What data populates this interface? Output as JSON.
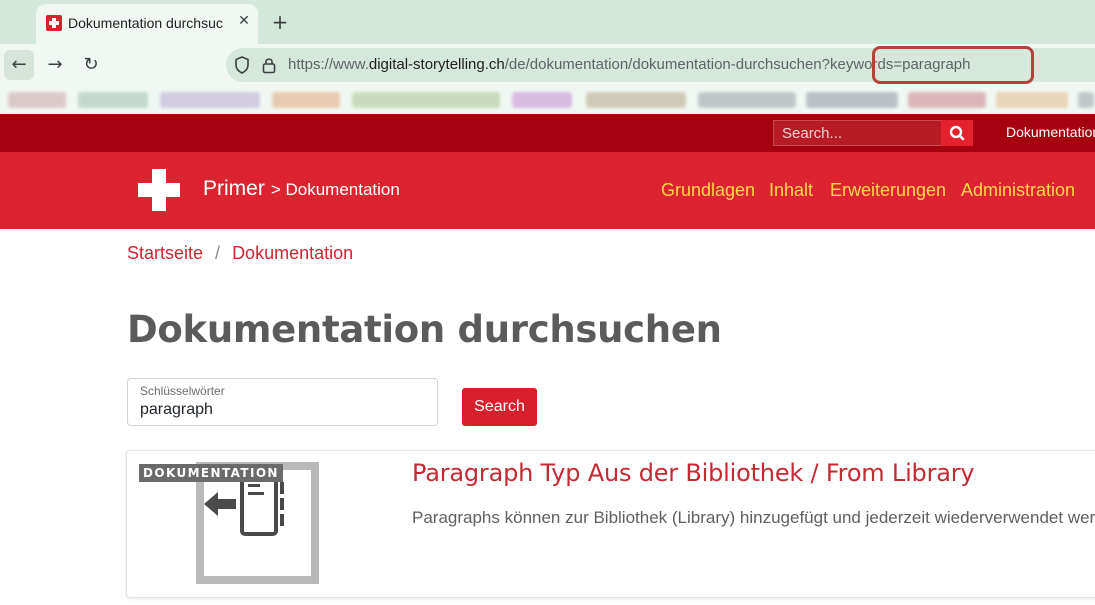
{
  "browser": {
    "tab": {
      "title": "Dokumentation durchsuc",
      "close_glyph": "✕"
    },
    "new_tab_glyph": "+",
    "nav": {
      "back_glyph": "←",
      "forward_glyph": "→",
      "reload_glyph": "↻"
    },
    "url": {
      "scheme": "https://www.",
      "host": "digital-storytelling.ch",
      "path": "/de/dokumentation/dokumentation-durchsuchen?keywords=paragraph"
    },
    "bookmarks_blurred": true
  },
  "site": {
    "topbar": {
      "search_placeholder": "Search...",
      "link": "Dokumentation"
    },
    "header": {
      "brand": "Primer",
      "section": "> Dokumentation",
      "nav": [
        "Grundlagen",
        "Inhalt",
        "Erweiterungen",
        "Administration"
      ]
    },
    "breadcrumb": {
      "items": [
        "Startseite",
        "Dokumentation"
      ],
      "separator": "/"
    },
    "page_title": "Dokumentation durchsuchen",
    "form": {
      "field_label": "Schlüsselwörter",
      "field_value": "paragraph",
      "submit_label": "Search"
    },
    "results": [
      {
        "badge": "DOKUMENTATION",
        "title": "Paragraph Typ Aus der Bibliothek / From Library",
        "description": "Paragraphs können zur Bibliothek (Library) hinzugefügt und jederzeit wiederverwendet werden."
      }
    ]
  },
  "colors": {
    "topbar": "#a5000f",
    "header": "#dc2430",
    "nav_link": "#ffd84a",
    "accent": "#d8202c",
    "url_highlight": "#b5413a"
  },
  "icons": [
    "page-favicon",
    "tab-close-icon",
    "plus-icon",
    "back-arrow-icon",
    "forward-arrow-icon",
    "reload-icon",
    "shield-icon",
    "lock-icon",
    "search-icon",
    "swiss-cross-logo",
    "library-import-icon"
  ]
}
